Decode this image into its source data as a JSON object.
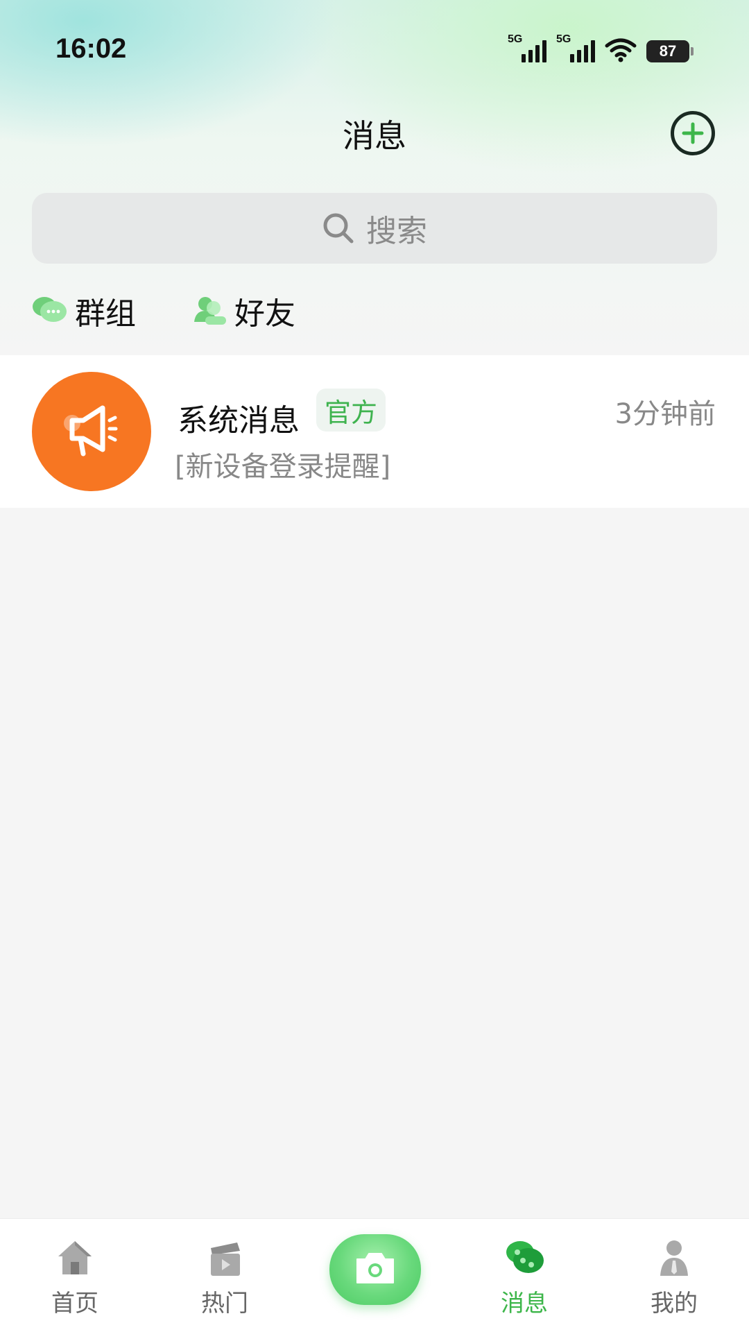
{
  "status_bar": {
    "time": "16:02",
    "signal1_label": "5G",
    "signal2_label": "5G",
    "battery": "87"
  },
  "header": {
    "title": "消息",
    "add_icon": "plus-circle-icon"
  },
  "search": {
    "label": "搜索",
    "icon": "search-icon"
  },
  "quick_links": [
    {
      "label": "群组",
      "icon": "group-chat-icon"
    },
    {
      "label": "好友",
      "icon": "friends-icon"
    }
  ],
  "messages": [
    {
      "title": "系统消息",
      "badge": "官方",
      "time": "3分钟前",
      "preview": "[新设备登录提醒]",
      "icon": "megaphone-icon",
      "avatar_color": "#f77622"
    }
  ],
  "tabbar": {
    "tabs": [
      {
        "label": "首页",
        "icon": "home-icon"
      },
      {
        "label": "热门",
        "icon": "clapperboard-icon"
      },
      {
        "label": "消息",
        "icon": "chat-icon",
        "active": true
      },
      {
        "label": "我的",
        "icon": "person-icon"
      }
    ],
    "center_icon": "camera-icon"
  },
  "colors": {
    "accent": "#3db64a",
    "badge_bg": "#eef4f0",
    "avatar": "#f77622"
  }
}
